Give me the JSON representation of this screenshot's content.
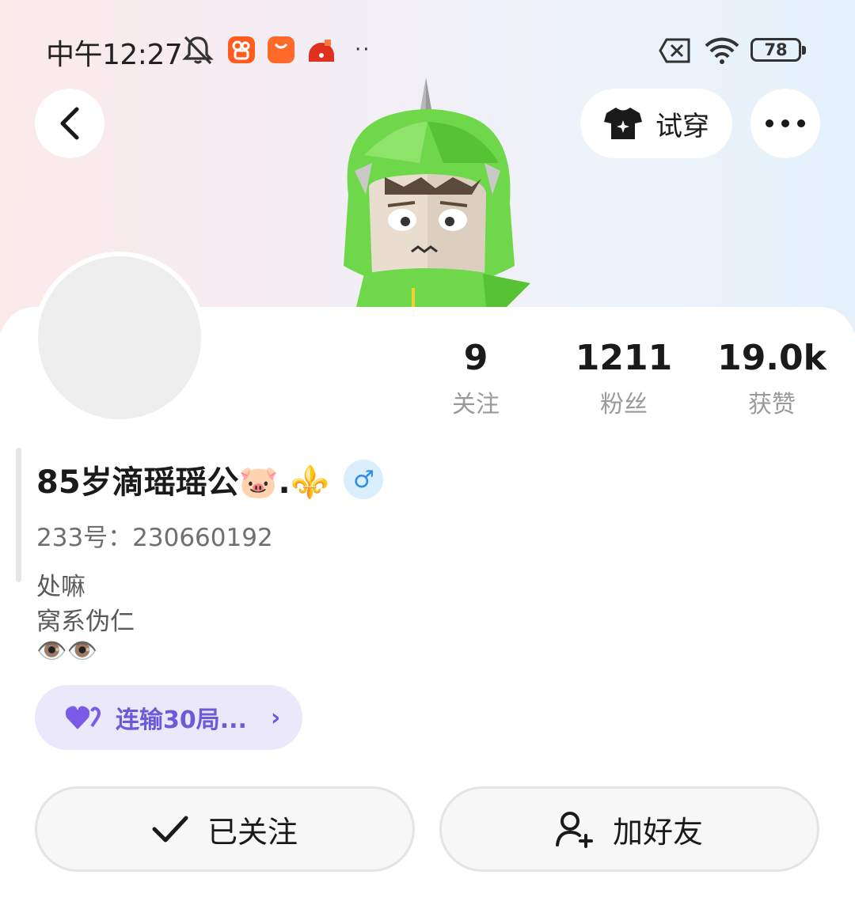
{
  "status_bar": {
    "time": "中午12:27",
    "more": "··",
    "battery": "78",
    "icons": [
      "mute-icon",
      "kuaishou-app-icon",
      "mi-store-app-icon",
      "game-app-icon",
      "sim-off-icon",
      "wifi-icon",
      "battery-icon"
    ]
  },
  "header": {
    "back_icon": "chevron-left-icon",
    "try_on_label": "试穿",
    "try_on_icon": "tshirt-icon",
    "more_icon": "more-horizontal-icon"
  },
  "stats": [
    {
      "value": "9",
      "label": "关注"
    },
    {
      "value": "1211",
      "label": "粉丝"
    },
    {
      "value": "19.0k",
      "label": "获赞"
    }
  ],
  "profile": {
    "username": "85岁滴瑶瑶公🐷.⚜️",
    "gender_symbol": "♂",
    "user_id": "233号：230660192",
    "bio": [
      "处嘛",
      "窝系伪仁",
      "👁️👁️"
    ]
  },
  "achievement": {
    "icon": "heart-icon",
    "label": "连输30局...",
    "chevron": "›"
  },
  "actions": {
    "followed_label": "已关注",
    "add_friend_label": "加好友"
  },
  "colors": {
    "accent_purple": "#6a5bd6",
    "chip_background": "#ebe8fb",
    "gender_blue": "#2e8ee6",
    "kuaishou_orange": "#ff5c1f",
    "character_green": "#6fd84a"
  }
}
